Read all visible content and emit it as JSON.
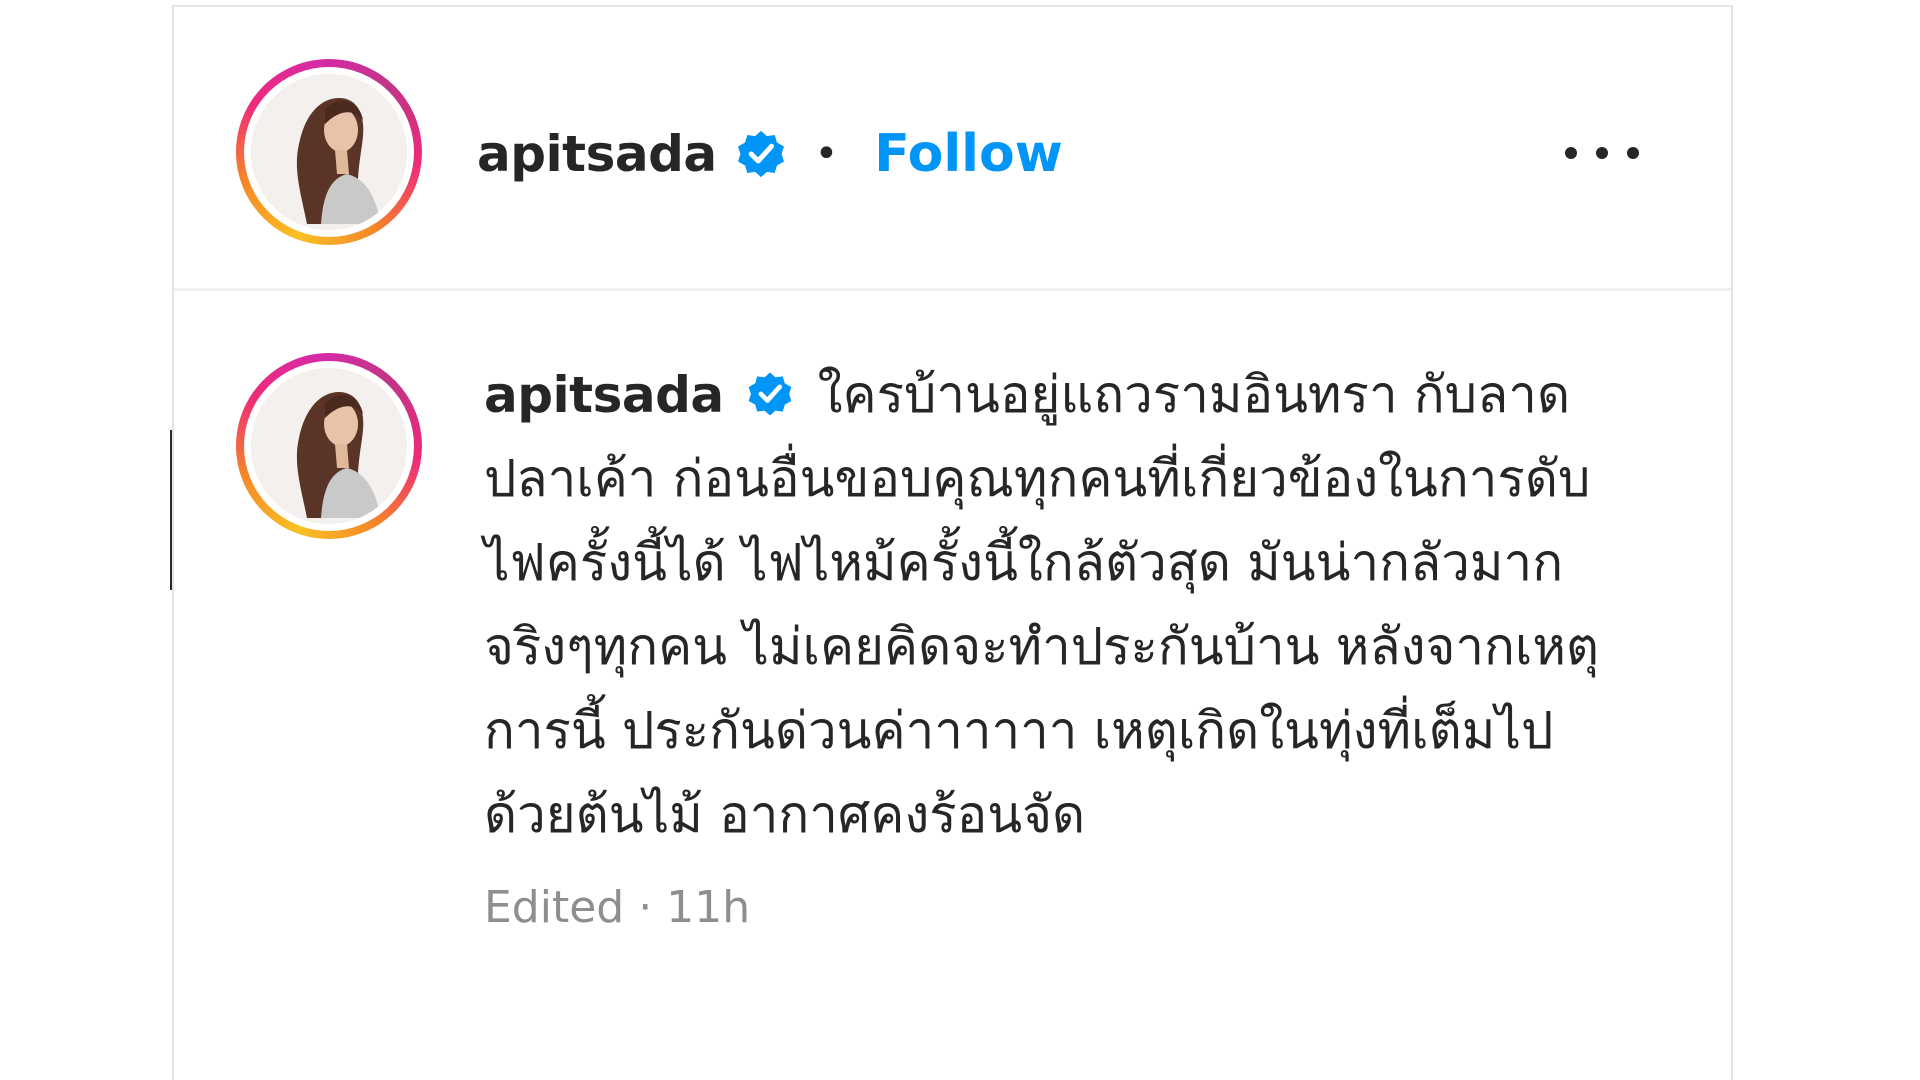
{
  "post": {
    "username": "apitsada",
    "separator": "•",
    "follow_label": "Follow",
    "more_label": "More options"
  },
  "comment": {
    "username": "apitsada",
    "text": "ใครบ้านอยู่แถวรามอินทรา กับลาดปลาเค้า ก่อนอื่นขอบคุณทุกคนที่เกี่ยวข้องในการดับไฟครั้งนี้ได้ ไฟไหม้ครั้งนี้ใกล้ตัวสุด มันน่ากลัวมากจริงๆทุกคน ไม่เคยคิดจะทำประกันบ้าน หลังจากเหตุการนี้ ประกันด่วนค่าาาาาา เหตุเกิดในทุ่งที่เต็มไปด้วยต้นไม้ อากาศคงร้อนจัด",
    "edited_label": "Edited",
    "meta_separator": "·",
    "time": "11h"
  },
  "colors": {
    "follow": "#0095f6",
    "verified": "#0095f6",
    "text": "#262626",
    "meta": "#8e8e8e"
  },
  "icons": {
    "verified": "verified-badge-icon",
    "more": "more-horizontal-icon"
  }
}
